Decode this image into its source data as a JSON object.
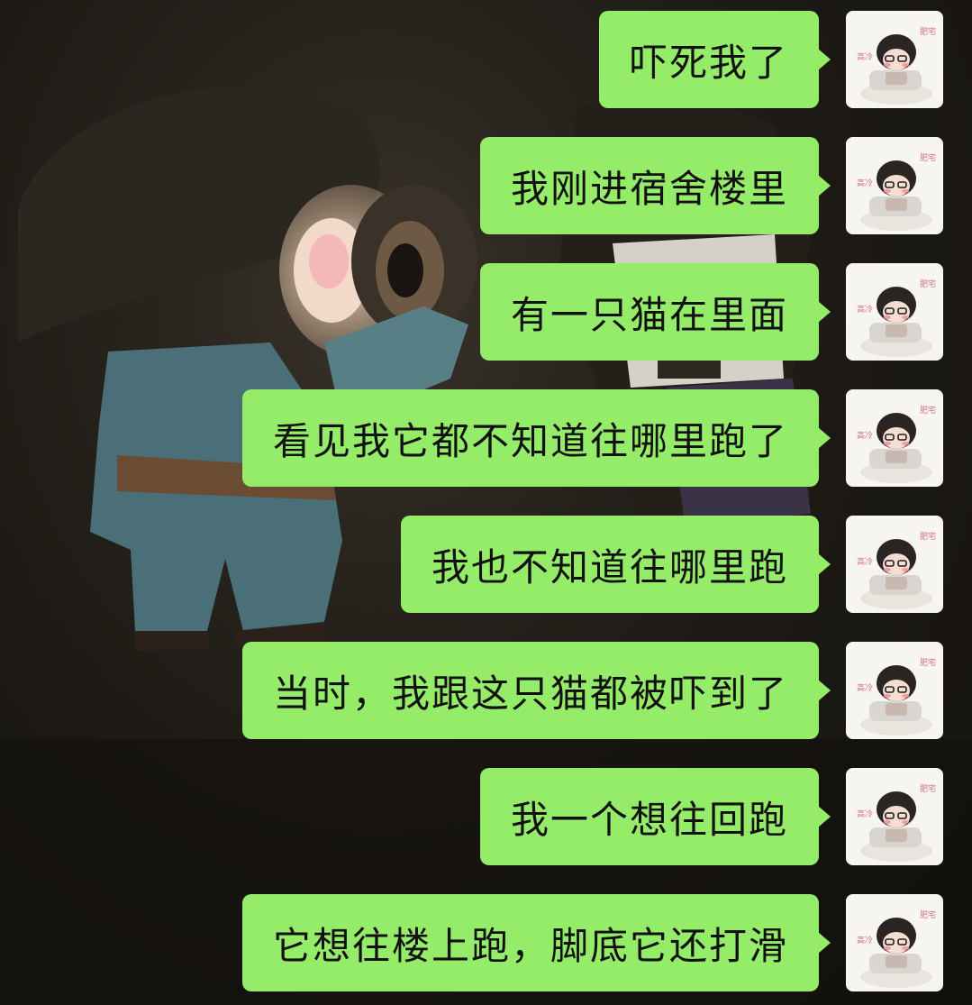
{
  "conversation": {
    "messages": [
      {
        "text": "吓死我了",
        "sender": "self"
      },
      {
        "text": "我刚进宿舍楼里",
        "sender": "self"
      },
      {
        "text": "有一只猫在里面",
        "sender": "self"
      },
      {
        "text": "看见我它都不知道往哪里跑了",
        "sender": "self"
      },
      {
        "text": "我也不知道往哪里跑",
        "sender": "self"
      },
      {
        "text": "当时，我跟这只猫都被吓到了",
        "sender": "self"
      },
      {
        "text": "我一个想往回跑",
        "sender": "self"
      },
      {
        "text": "它想往楼上跑，脚底它还打滑",
        "sender": "self"
      }
    ],
    "avatar_icon": "avatar-cartoon-character-icon"
  },
  "colors": {
    "bubble": "#95ec69",
    "bubble_text": "#111111",
    "avatar_bg": "#f7f5f2",
    "backdrop": "#151310"
  }
}
